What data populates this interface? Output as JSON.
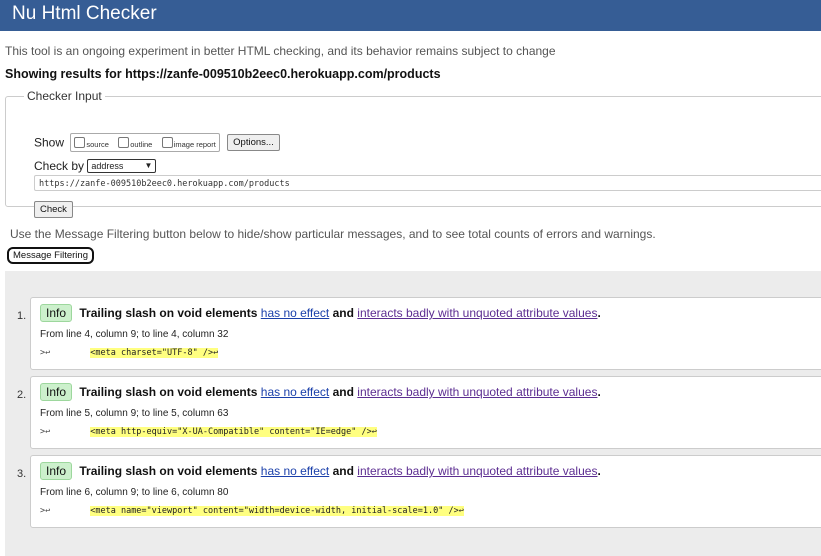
{
  "app": {
    "title": "Nu Html Checker"
  },
  "intro": "This tool is an ongoing experiment in better HTML checking, and its behavior remains subject to change",
  "showing": "Showing results for https://zanfe-009510b2eec0.herokuapp.com/products",
  "checker": {
    "legend": "Checker Input",
    "show_label": "Show",
    "options": [
      "source",
      "outline",
      "image report"
    ],
    "options_button": "Options...",
    "check_by_label": "Check by",
    "check_by_value": "address",
    "url_value": "https://zanfe-009510b2eec0.herokuapp.com/products",
    "check_button": "Check"
  },
  "filter": {
    "note": "Use the Message Filtering button below to hide/show particular messages, and to see total counts of errors and warnings.",
    "button": "Message Filtering"
  },
  "messages": [
    {
      "num": "1.",
      "type": "Info",
      "text": "Trailing slash on void elements",
      "link1": "has no effect",
      "and": "and",
      "link2": "interacts badly with unquoted attribute values",
      "period": ".",
      "location": "From line 4, column 9; to line 4, column 32",
      "code_prefix": ">↩",
      "code": "<meta charset=\"UTF-8\" />↩"
    },
    {
      "num": "2.",
      "type": "Info",
      "text": "Trailing slash on void elements",
      "link1": "has no effect",
      "and": "and",
      "link2": "interacts badly with unquoted attribute values",
      "period": ".",
      "location": "From line 5, column 9; to line 5, column 63",
      "code_prefix": ">↩",
      "code": "<meta http-equiv=\"X-UA-Compatible\" content=\"IE=edge\" />↩"
    },
    {
      "num": "3.",
      "type": "Info",
      "text": "Trailing slash on void elements",
      "link1": "has no effect",
      "and": "and",
      "link2": "interacts badly with unquoted attribute values",
      "period": ".",
      "location": "From line 6, column 9; to line 6, column 80",
      "code_prefix": ">↩",
      "code": "<meta name=\"viewport\" content=\"width=device-width, initial-scale=1.0\" />↩"
    }
  ],
  "colors": {
    "header": "#365d95",
    "info_badge": "#ccf0cc",
    "highlight": "#ffff80"
  }
}
